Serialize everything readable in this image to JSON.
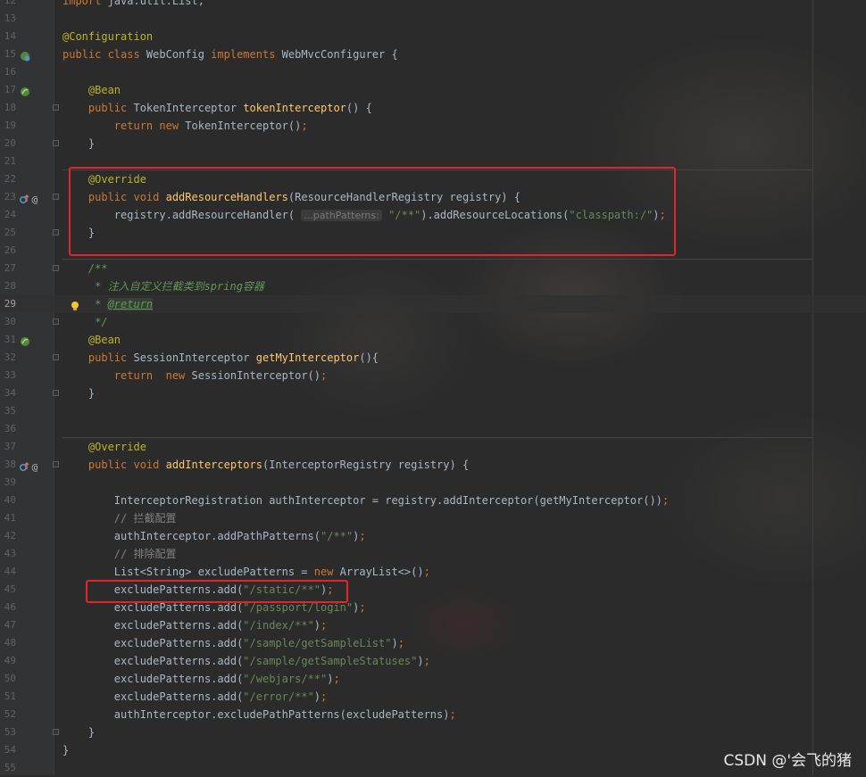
{
  "editor": {
    "language": "java",
    "lines": [
      {
        "n": "12",
        "code": [
          {
            "t": "k",
            "v": "import "
          },
          {
            "t": "p",
            "v": "java.util.List;"
          }
        ]
      },
      {
        "n": "13",
        "code": []
      },
      {
        "n": "14",
        "code": [
          {
            "t": "a",
            "v": "@Configuration"
          }
        ]
      },
      {
        "n": "15",
        "code": [
          {
            "t": "k",
            "v": "public class "
          },
          {
            "t": "p",
            "v": "WebConfig "
          },
          {
            "t": "k",
            "v": "implements "
          },
          {
            "t": "p",
            "v": "WebMvcConfigurer {"
          }
        ],
        "marker": "bean-config-icon"
      },
      {
        "n": "16",
        "code": []
      },
      {
        "n": "17",
        "code": [
          {
            "t": "p",
            "v": "    "
          },
          {
            "t": "a",
            "v": "@Bean"
          }
        ],
        "marker": "bean-icon"
      },
      {
        "n": "18",
        "code": [
          {
            "t": "p",
            "v": "    "
          },
          {
            "t": "k",
            "v": "public "
          },
          {
            "t": "p",
            "v": "TokenInterceptor "
          },
          {
            "t": "m",
            "v": "tokenInterceptor"
          },
          {
            "t": "p",
            "v": "() {"
          }
        ],
        "fold": true
      },
      {
        "n": "19",
        "code": [
          {
            "t": "p",
            "v": "        "
          },
          {
            "t": "k",
            "v": "return new "
          },
          {
            "t": "p",
            "v": "TokenInterceptor()"
          },
          {
            "t": "k",
            "v": ";"
          }
        ]
      },
      {
        "n": "20",
        "code": [
          {
            "t": "p",
            "v": "    }"
          }
        ],
        "fold": true
      },
      {
        "n": "21",
        "code": []
      },
      {
        "n": "22",
        "code": [
          {
            "t": "p",
            "v": "    "
          },
          {
            "t": "a",
            "v": "@Override"
          }
        ],
        "sep_before": true
      },
      {
        "n": "23",
        "code": [
          {
            "t": "p",
            "v": "    "
          },
          {
            "t": "k",
            "v": "public void "
          },
          {
            "t": "m",
            "v": "addResourceHandlers"
          },
          {
            "t": "p",
            "v": "(ResourceHandlerRegistry registry) {"
          }
        ],
        "marker": "override-icon",
        "fold": true
      },
      {
        "n": "24",
        "code": [
          {
            "t": "p",
            "v": "        registry.addResourceHandler( "
          },
          {
            "t": "h",
            "v": "...pathPatterns:"
          },
          {
            "t": "p",
            "v": " "
          },
          {
            "t": "s",
            "v": "\"/**\""
          },
          {
            "t": "p",
            "v": ").addResourceLocations("
          },
          {
            "t": "s",
            "v": "\"classpath:/\""
          },
          {
            "t": "p",
            "v": ")"
          },
          {
            "t": "k",
            "v": ";"
          }
        ]
      },
      {
        "n": "25",
        "code": [
          {
            "t": "p",
            "v": "    }"
          }
        ],
        "fold": true
      },
      {
        "n": "26",
        "code": []
      },
      {
        "n": "27",
        "code": [
          {
            "t": "p",
            "v": "    "
          },
          {
            "t": "d",
            "v": "/**"
          }
        ],
        "sep_before": true,
        "fold": true
      },
      {
        "n": "28",
        "code": [
          {
            "t": "p",
            "v": "     "
          },
          {
            "t": "d",
            "v": "* 注入自定义拦截类到spring容器"
          }
        ]
      },
      {
        "n": "29",
        "code": [
          {
            "t": "p",
            "v": "     "
          },
          {
            "t": "d",
            "v": "* "
          },
          {
            "t": "dt",
            "v": "@return"
          }
        ],
        "marker": "bulb-icon",
        "current": true
      },
      {
        "n": "30",
        "code": [
          {
            "t": "p",
            "v": "     "
          },
          {
            "t": "d",
            "v": "*/"
          }
        ],
        "fold": true
      },
      {
        "n": "31",
        "code": [
          {
            "t": "p",
            "v": "    "
          },
          {
            "t": "a",
            "v": "@Bean"
          }
        ],
        "marker": "bean-icon"
      },
      {
        "n": "32",
        "code": [
          {
            "t": "p",
            "v": "    "
          },
          {
            "t": "k",
            "v": "public "
          },
          {
            "t": "p",
            "v": "SessionInterceptor "
          },
          {
            "t": "m",
            "v": "getMyInterceptor"
          },
          {
            "t": "p",
            "v": "(){"
          }
        ],
        "fold": true
      },
      {
        "n": "33",
        "code": [
          {
            "t": "p",
            "v": "        "
          },
          {
            "t": "k",
            "v": "return  new "
          },
          {
            "t": "p",
            "v": "SessionInterceptor()"
          },
          {
            "t": "k",
            "v": ";"
          }
        ]
      },
      {
        "n": "34",
        "code": [
          {
            "t": "p",
            "v": "    }"
          }
        ],
        "fold": true
      },
      {
        "n": "35",
        "code": []
      },
      {
        "n": "36",
        "code": []
      },
      {
        "n": "37",
        "code": [
          {
            "t": "p",
            "v": "    "
          },
          {
            "t": "a",
            "v": "@Override"
          }
        ],
        "sep_before": true
      },
      {
        "n": "38",
        "code": [
          {
            "t": "p",
            "v": "    "
          },
          {
            "t": "k",
            "v": "public void "
          },
          {
            "t": "m",
            "v": "addInterceptors"
          },
          {
            "t": "p",
            "v": "(InterceptorRegistry registry) {"
          }
        ],
        "marker": "override-icon",
        "fold": true
      },
      {
        "n": "39",
        "code": []
      },
      {
        "n": "40",
        "code": [
          {
            "t": "p",
            "v": "        InterceptorRegistration authInterceptor = registry.addInterceptor(getMyInterceptor())"
          },
          {
            "t": "k",
            "v": ";"
          }
        ]
      },
      {
        "n": "41",
        "code": [
          {
            "t": "p",
            "v": "        "
          },
          {
            "t": "c",
            "v": "// 拦截配置"
          }
        ]
      },
      {
        "n": "42",
        "code": [
          {
            "t": "p",
            "v": "        authInterceptor.addPathPatterns("
          },
          {
            "t": "s",
            "v": "\"/**\""
          },
          {
            "t": "p",
            "v": ")"
          },
          {
            "t": "k",
            "v": ";"
          }
        ]
      },
      {
        "n": "43",
        "code": [
          {
            "t": "p",
            "v": "        "
          },
          {
            "t": "c",
            "v": "// 排除配置"
          }
        ]
      },
      {
        "n": "44",
        "code": [
          {
            "t": "p",
            "v": "        List<String> excludePatterns = "
          },
          {
            "t": "k",
            "v": "new "
          },
          {
            "t": "p",
            "v": "ArrayList<>()"
          },
          {
            "t": "k",
            "v": ";"
          }
        ]
      },
      {
        "n": "45",
        "code": [
          {
            "t": "p",
            "v": "        excludePatterns.add("
          },
          {
            "t": "s",
            "v": "\"/static/**\""
          },
          {
            "t": "p",
            "v": ")"
          },
          {
            "t": "k",
            "v": ";"
          }
        ]
      },
      {
        "n": "46",
        "code": [
          {
            "t": "p",
            "v": "        excludePatterns.add("
          },
          {
            "t": "s",
            "v": "\"/passport/login\""
          },
          {
            "t": "p",
            "v": ")"
          },
          {
            "t": "k",
            "v": ";"
          }
        ]
      },
      {
        "n": "47",
        "code": [
          {
            "t": "p",
            "v": "        excludePatterns.add("
          },
          {
            "t": "s",
            "v": "\"/index/**\""
          },
          {
            "t": "p",
            "v": ")"
          },
          {
            "t": "k",
            "v": ";"
          }
        ]
      },
      {
        "n": "48",
        "code": [
          {
            "t": "p",
            "v": "        excludePatterns.add("
          },
          {
            "t": "s",
            "v": "\"/sample/getSampleList\""
          },
          {
            "t": "p",
            "v": ")"
          },
          {
            "t": "k",
            "v": ";"
          }
        ]
      },
      {
        "n": "49",
        "code": [
          {
            "t": "p",
            "v": "        excludePatterns.add("
          },
          {
            "t": "s",
            "v": "\"/sample/getSampleStatuses\""
          },
          {
            "t": "p",
            "v": ")"
          },
          {
            "t": "k",
            "v": ";"
          }
        ]
      },
      {
        "n": "50",
        "code": [
          {
            "t": "p",
            "v": "        excludePatterns.add("
          },
          {
            "t": "s",
            "v": "\"/webjars/**\""
          },
          {
            "t": "p",
            "v": ")"
          },
          {
            "t": "k",
            "v": ";"
          }
        ]
      },
      {
        "n": "51",
        "code": [
          {
            "t": "p",
            "v": "        excludePatterns.add("
          },
          {
            "t": "s",
            "v": "\"/error/**\""
          },
          {
            "t": "p",
            "v": ")"
          },
          {
            "t": "k",
            "v": ";"
          }
        ]
      },
      {
        "n": "52",
        "code": [
          {
            "t": "p",
            "v": "        authInterceptor.excludePathPatterns(excludePatterns)"
          },
          {
            "t": "k",
            "v": ";"
          }
        ]
      },
      {
        "n": "53",
        "code": [
          {
            "t": "p",
            "v": "    }"
          }
        ],
        "fold": true
      },
      {
        "n": "54",
        "code": [
          {
            "t": "p",
            "v": "}"
          }
        ]
      },
      {
        "n": "55",
        "code": []
      }
    ]
  },
  "colors": {
    "background": "#2b2b2b",
    "keyword": "#cc7832",
    "annotation": "#bbb529",
    "method": "#ffc66d",
    "string": "#6a8759",
    "comment": "#808080",
    "doc_comment": "#629755",
    "highlight_box": "#e0262b"
  },
  "watermark": "CSDN @'会飞的猪"
}
